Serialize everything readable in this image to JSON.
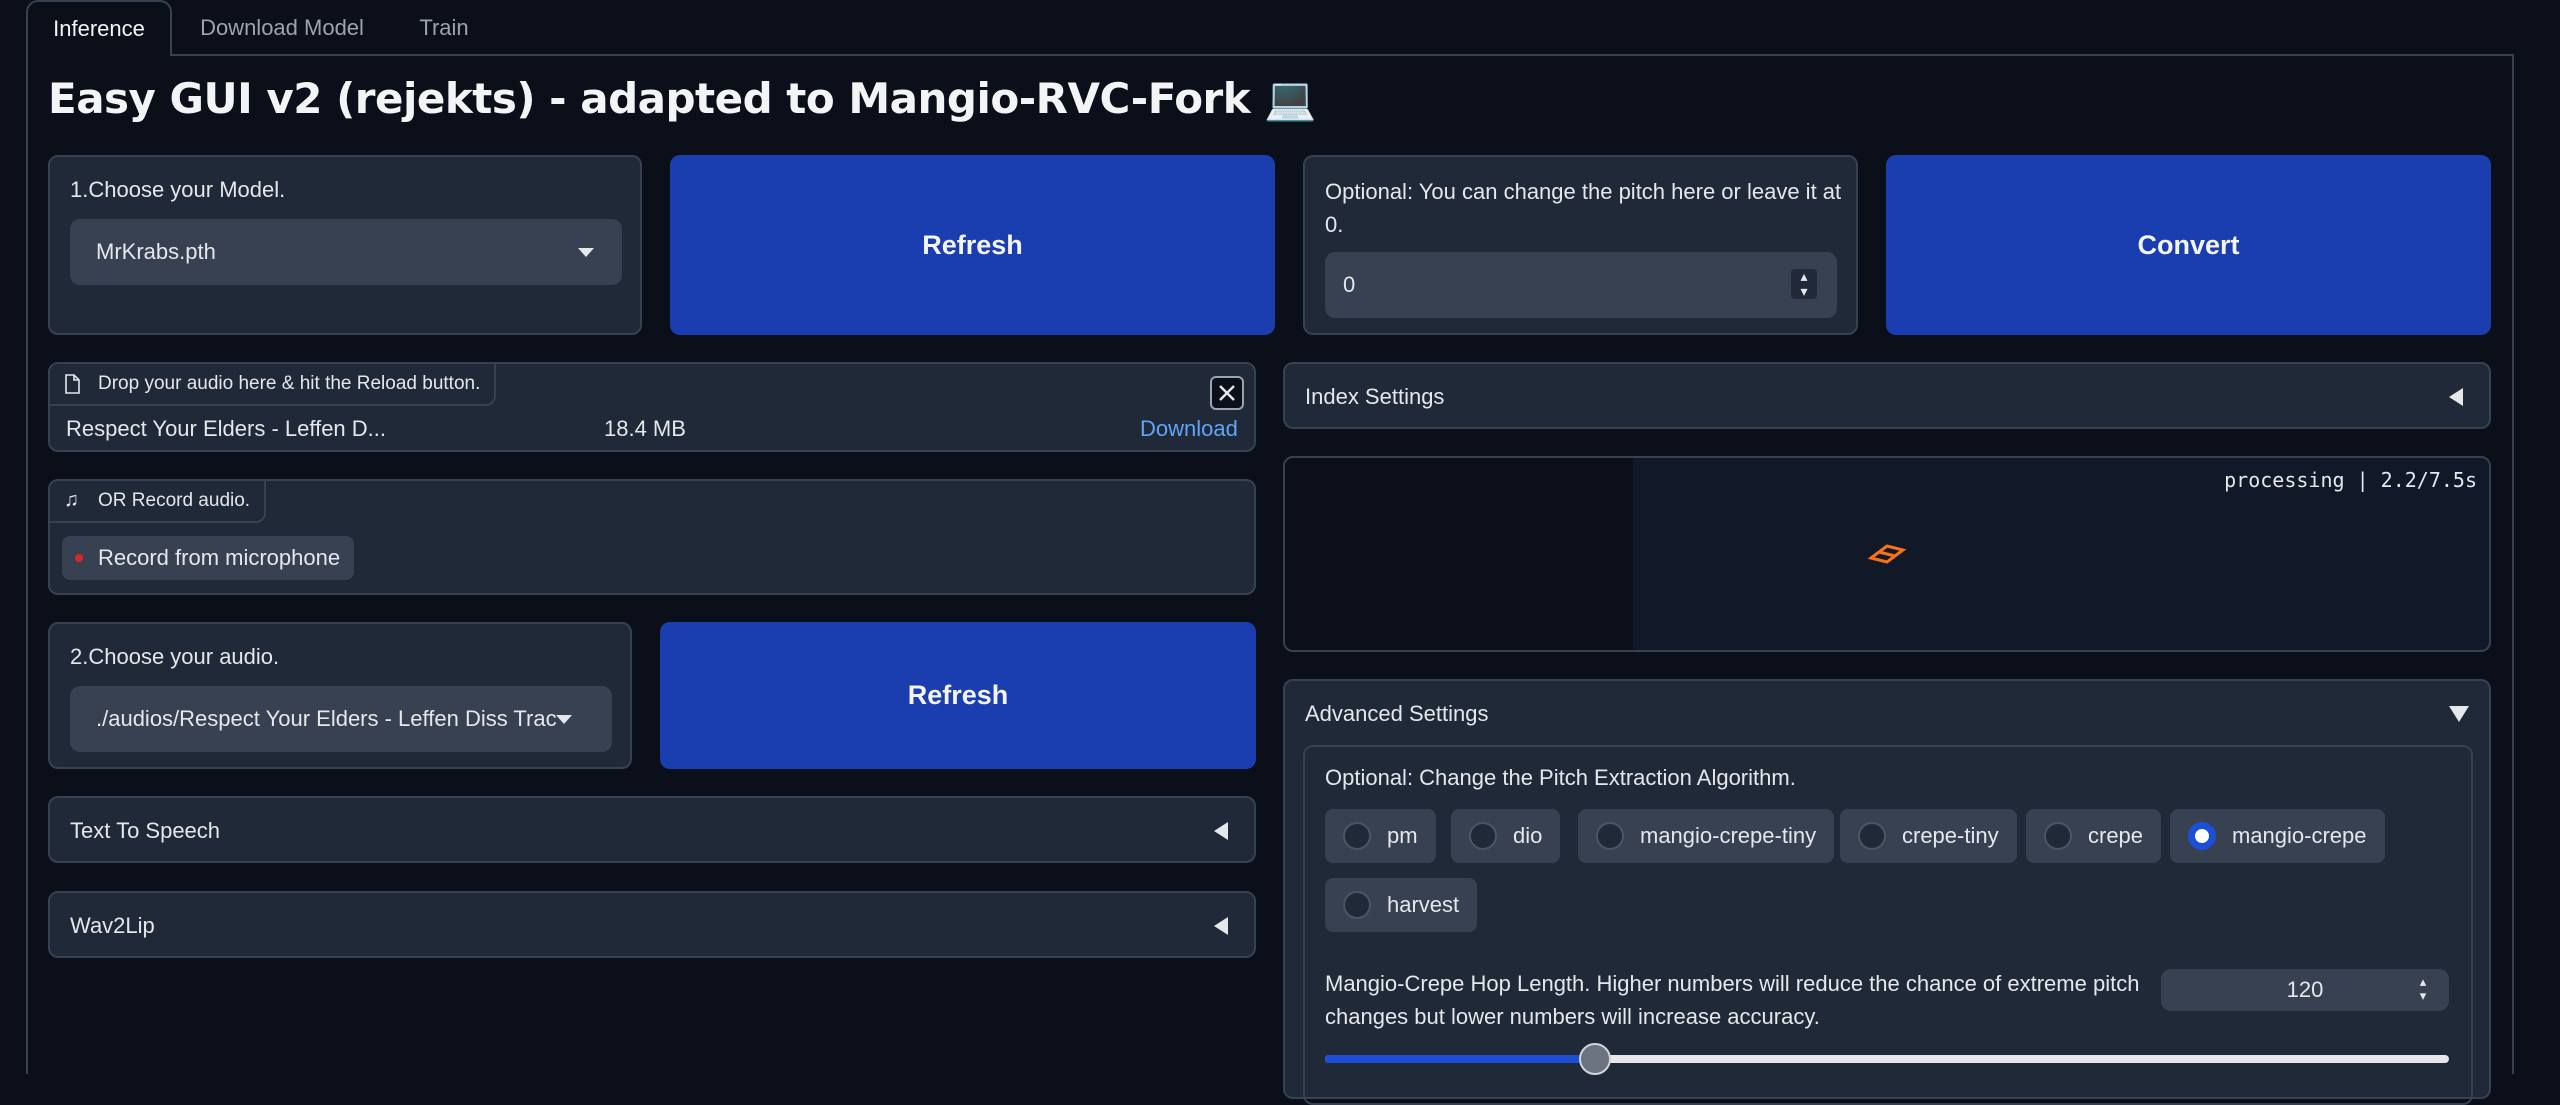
{
  "tabs": [
    "Inference",
    "Download Model",
    "Train"
  ],
  "title": "Easy GUI v2 (rejekts) - adapted to Mangio-RVC-Fork 💻",
  "model": {
    "label": "1.Choose your Model.",
    "value": "MrKrabs.pth"
  },
  "refresh_label": "Refresh",
  "pitch": {
    "label": "Optional: You can change the pitch here or leave it at 0.",
    "value": "0"
  },
  "convert_label": "Convert",
  "upload": {
    "label": "Drop your audio here & hit the Reload button.",
    "file_name": "Respect Your Elders - Leffen D...",
    "file_size": "18.4 MB",
    "download_label": "Download"
  },
  "record": {
    "label": "OR Record audio.",
    "button_label": "Record from microphone"
  },
  "audio": {
    "label": "2.Choose your audio.",
    "value": "./audios/Respect Your Elders - Leffen Diss Trac"
  },
  "tts_label": "Text To Speech",
  "wav2lip_label": "Wav2Lip",
  "index_settings_label": "Index Settings",
  "output": {
    "status": "processing | 2.2/7.5s",
    "accent": "#f97316"
  },
  "advanced": {
    "label": "Advanced Settings",
    "pitch_algo_label": "Optional: Change the Pitch Extraction Algorithm.",
    "options": [
      "pm",
      "dio",
      "mangio-crepe-tiny",
      "crepe-tiny",
      "crepe",
      "mangio-crepe",
      "harvest"
    ],
    "selected": "mangio-crepe",
    "hop_label": "Mangio-Crepe Hop Length. Higher numbers will reduce the chance of extreme pitch changes but lower numbers will increase accuracy.",
    "hop_value": "120",
    "hop_fraction": 0.24
  },
  "colors": {
    "primary": "#1a3db0",
    "panel": "#1f2937",
    "background": "#0b0f19",
    "link": "#60a5fa"
  }
}
